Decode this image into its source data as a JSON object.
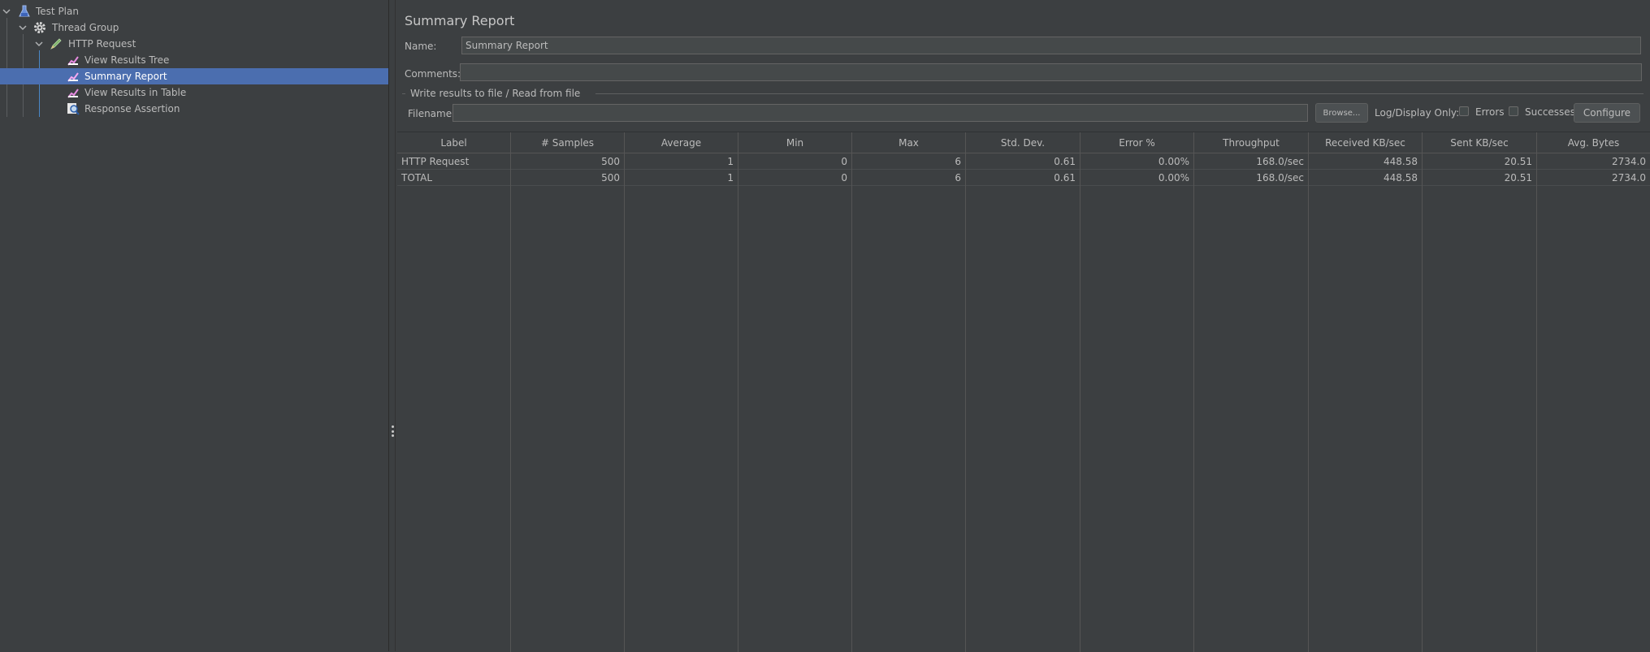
{
  "tree": {
    "items": [
      {
        "label": "Test Plan",
        "icon": "flask-icon"
      },
      {
        "label": "Thread Group",
        "icon": "gear-icon"
      },
      {
        "label": "HTTP Request",
        "icon": "pen-icon"
      },
      {
        "label": "View Results Tree",
        "icon": "chart-icon"
      },
      {
        "label": "Summary Report",
        "icon": "chart-icon"
      },
      {
        "label": "View Results in Table",
        "icon": "chart-icon"
      },
      {
        "label": "Response Assertion",
        "icon": "magnifier-icon"
      }
    ]
  },
  "panel": {
    "title": "Summary Report",
    "name_label": "Name:",
    "name_value": "Summary Report",
    "comments_label": "Comments:",
    "comments_value": "",
    "file_group_label": "Write results to file / Read from file",
    "filename_label": "Filename",
    "filename_value": "",
    "browse_label": "Browse...",
    "log_display_label": "Log/Display Only:",
    "errors_label": "Errors",
    "successes_label": "Successes",
    "configure_label": "Configure"
  },
  "table": {
    "headers": [
      "Label",
      "# Samples",
      "Average",
      "Min",
      "Max",
      "Std. Dev.",
      "Error %",
      "Throughput",
      "Received KB/sec",
      "Sent KB/sec",
      "Avg. Bytes"
    ],
    "rows": [
      [
        "HTTP Request",
        "500",
        "1",
        "0",
        "6",
        "0.61",
        "0.00%",
        "168.0/sec",
        "448.58",
        "20.51",
        "2734.0"
      ],
      [
        "TOTAL",
        "500",
        "1",
        "0",
        "6",
        "0.61",
        "0.00%",
        "168.0/sec",
        "448.58",
        "20.51",
        "2734.0"
      ]
    ]
  },
  "colors": {
    "background": "#3c3f41",
    "selection": "#4b6eaf",
    "text": "#bbbbbb"
  }
}
